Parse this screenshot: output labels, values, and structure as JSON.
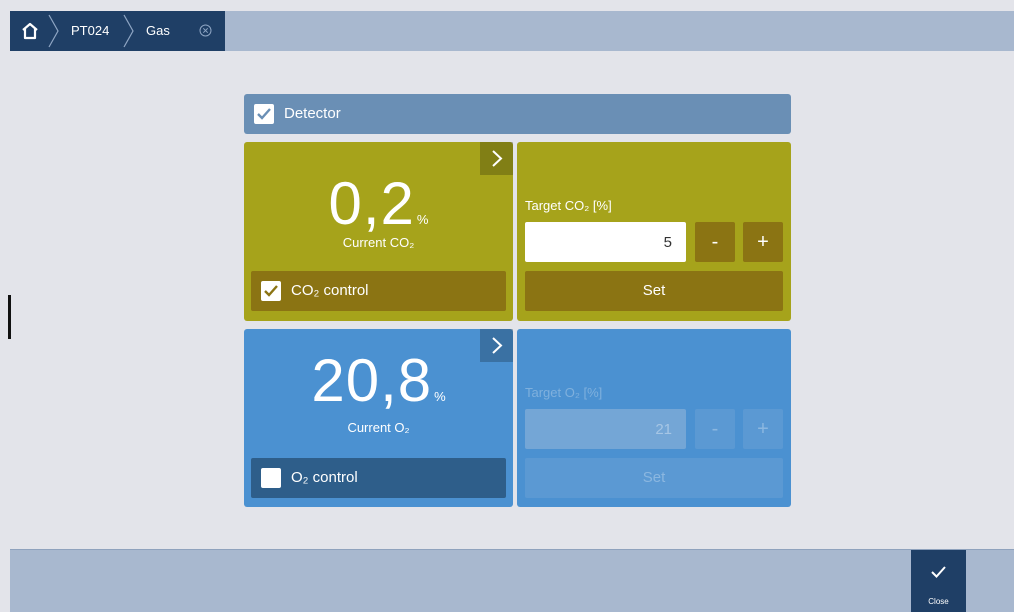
{
  "breadcrumb": {
    "items": [
      "PT024",
      "Gas"
    ],
    "home_icon": "home-icon",
    "close_icon": "close-circle-icon"
  },
  "detector": {
    "label": "Detector",
    "checked": true
  },
  "co2": {
    "current_value": "0,2",
    "unit": "%",
    "current_label": "Current CO₂",
    "control_label": "CO₂ control",
    "control_checked": true,
    "target_label": "Target CO₂ [%]",
    "target_value": "5",
    "minus": "-",
    "plus": "+",
    "set_label": "Set",
    "color": "#a6a31b"
  },
  "o2": {
    "current_value": "20,8",
    "unit": "%",
    "current_label": "Current O₂",
    "control_label": "O₂ control",
    "control_checked": false,
    "target_label": "Target O₂ [%]",
    "target_value": "21",
    "minus": "-",
    "plus": "+",
    "set_label": "Set",
    "color": "#4b91d1"
  },
  "footer": {
    "close_label": "Close"
  }
}
